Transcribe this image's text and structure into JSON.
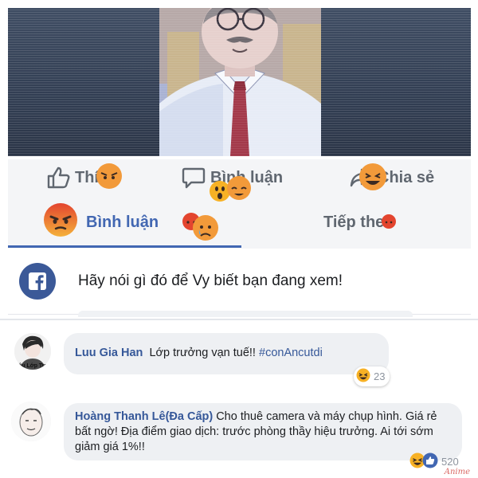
{
  "actions": {
    "like_label": "Thích",
    "comment_label": "Bình luận",
    "share_label": "Chia sẻ"
  },
  "tabs": {
    "active_label": "Bình luận",
    "next_label": "Tiếp the"
  },
  "prompt": {
    "text": "Hãy nói gì đó để Vy biết bạn đang xem!"
  },
  "comments": [
    {
      "avatar_caption": "iệu Lớp Trư",
      "author": "Luu Gia Han",
      "text": "Lớp trưởng vạn tuế!!",
      "hashtag": "#conAncutdi",
      "reaction_count": "23",
      "reaction_icon": "laughing-emoji-icon"
    },
    {
      "author": "Hoàng Thanh Lê(Đa Cấp)",
      "text": "Cho thuê camera và máy chụp hình. Giá rẻ bất ngờ! Địa điểm giao dịch: trước phòng thầy hiệu trưởng. Ai tới sớm giảm giá 1%!!",
      "reaction_count": "520",
      "reaction_icons": [
        "laughing-emoji-icon",
        "like-icon"
      ]
    }
  ],
  "watermark": "Anime",
  "colors": {
    "facebook_blue": "#4267b2",
    "link_blue": "#365899",
    "gray_text": "#606770",
    "angry_red": "#e0533a",
    "reaction_yellow": "#f7b125"
  }
}
